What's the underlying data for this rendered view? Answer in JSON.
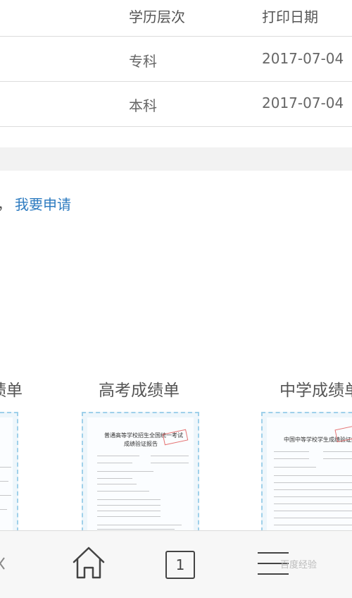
{
  "table": {
    "header": {
      "level": "学历层次",
      "date": "打印日期"
    },
    "rows": [
      {
        "level": "专科",
        "date": "2017-07-04"
      },
      {
        "level": "本科",
        "date": "2017-07-04"
      }
    ]
  },
  "apply": {
    "prefix": "，",
    "link": "我要申请"
  },
  "samples": [
    {
      "title": "绩单"
    },
    {
      "title": "高考成绩单",
      "doc_heading": "普通高等学校招生全国统一考试",
      "doc_subheading": "成绩验证报告"
    },
    {
      "title": "中学成绩单",
      "doc_heading": "中国中等学校学生成绩验证报告"
    }
  ],
  "bottom_nav": {
    "tabs_count": "1",
    "watermark": "百度经验"
  },
  "colors": {
    "link": "#2d7bc0",
    "stamp": "#e05a5a",
    "doc_border": "#9fd0ea"
  }
}
